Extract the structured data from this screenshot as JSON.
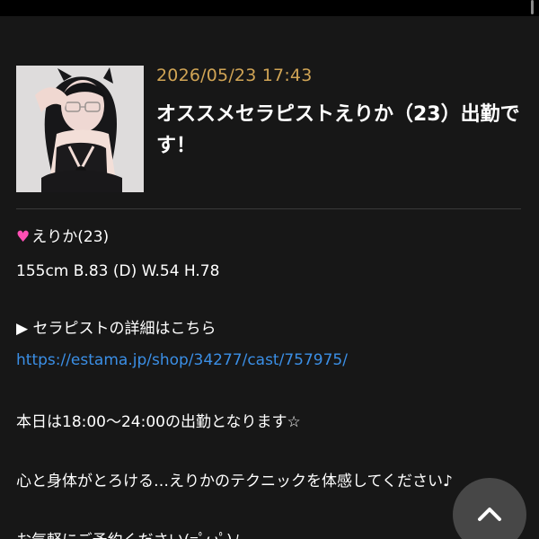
{
  "post": {
    "date": "2026/05/23 17:43",
    "title": "オススメセラピストえりか（23）出勤です！",
    "image_alt": "えりか"
  },
  "content": {
    "heart_icon": "heart-icon",
    "name_line": "えりか(23)",
    "stats_line": "155cm B.83 (D) W.54 H.78",
    "detail_heading": "▶ セラピストの詳細はこちら",
    "detail_link": "https://estama.jp/shop/34277/cast/757975/",
    "schedule_line": "本日は18:00〜24:00の出勤となります☆",
    "message_line": "心と身体がとろける…えりかのテクニックを体感してください♪",
    "booking_line": "お気軽にご予約ください(=ﾟωﾟ)ﾉ"
  },
  "controls": {
    "scroll_to_top_icon": "chevron-up-icon"
  },
  "colors": {
    "background": "#171717",
    "date": "#d0a455",
    "link": "#3b8fe6",
    "heart": "#ff4fb5",
    "button": "#474747"
  }
}
